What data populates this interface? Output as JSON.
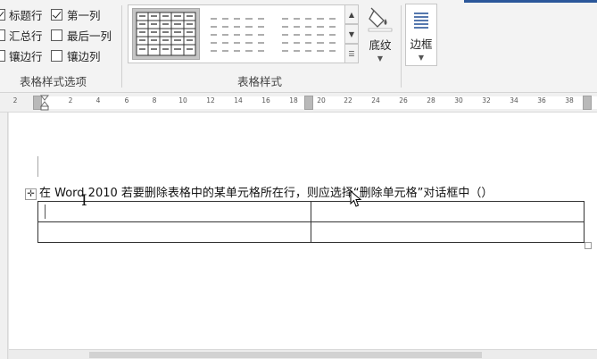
{
  "ribbon": {
    "style_options": {
      "group_label": "表格样式选项",
      "items": [
        {
          "label": "标题行",
          "checked": true
        },
        {
          "label": "第一列",
          "checked": true
        },
        {
          "label": "汇总行",
          "checked": false
        },
        {
          "label": "最后一列",
          "checked": false
        },
        {
          "label": "镶边行",
          "checked": false
        },
        {
          "label": "镶边列",
          "checked": false
        }
      ]
    },
    "table_styles": {
      "group_label": "表格样式"
    },
    "shading": {
      "label": "底纹",
      "icon": "paint-bucket-icon"
    },
    "borders": {
      "label": "边框",
      "icon": "borders-icon"
    }
  },
  "ruler": {
    "ticks": [
      "2",
      "2",
      "4",
      "6",
      "8",
      "10",
      "12",
      "14",
      "16",
      "18",
      "20",
      "22",
      "24",
      "26",
      "28",
      "30",
      "32",
      "34",
      "36",
      "38"
    ]
  },
  "document": {
    "question_text": "在 Word 2010 若要删除表格中的某单元格所在行，则应选择“删除单元格”对话框中（）",
    "table": {
      "rows": 2,
      "cols": 2
    }
  },
  "colors": {
    "ribbon_bg": "#f3f3f3",
    "accent": "#2b579a",
    "page": "#ffffff"
  }
}
